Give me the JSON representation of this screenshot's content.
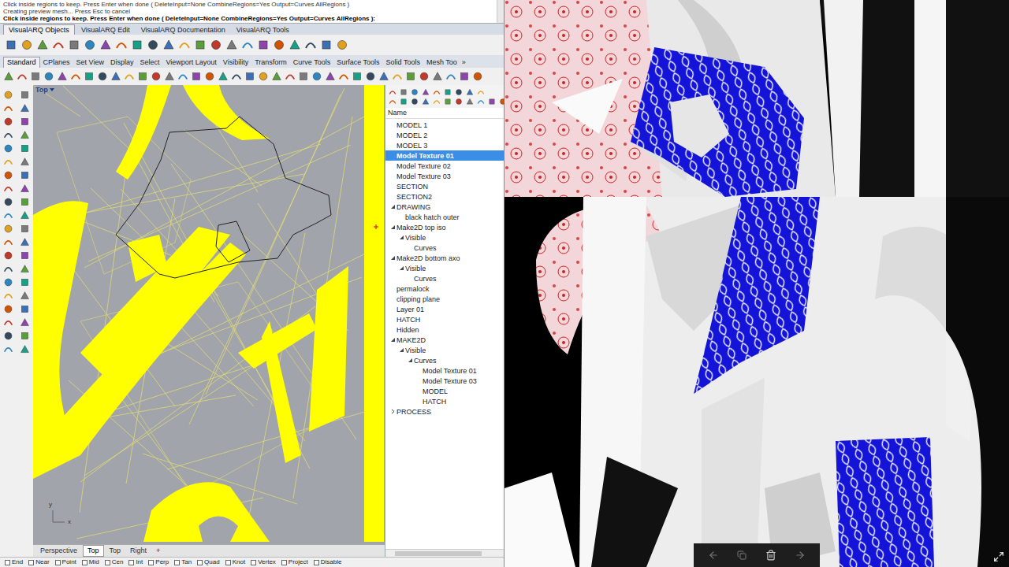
{
  "command": {
    "history": [
      "Click inside regions to keep. Press Enter when done ( DeleteInput=None  CombineRegions=Yes  Output=Curves  AllRegions )",
      "Creating preview mesh... Press Esc to cancel"
    ],
    "prompt": "Click inside regions to keep. Press Enter when done ( DeleteInput=None  CombineRegions=Yes  Output=Curves  AllRegions ):"
  },
  "plugin_tabs": [
    {
      "label": "VisualARQ Objects",
      "selected": true
    },
    {
      "label": "VisualARQ Edit",
      "selected": false
    },
    {
      "label": "VisualARQ Documentation",
      "selected": false
    },
    {
      "label": "VisualARQ Tools",
      "selected": false
    }
  ],
  "toolbar_tabs": [
    {
      "label": "Standard",
      "selected": true
    },
    {
      "label": "CPlanes",
      "selected": false
    },
    {
      "label": "Set View",
      "selected": false
    },
    {
      "label": "Display",
      "selected": false
    },
    {
      "label": "Select",
      "selected": false
    },
    {
      "label": "Viewport Layout",
      "selected": false
    },
    {
      "label": "Visibility",
      "selected": false
    },
    {
      "label": "Transform",
      "selected": false
    },
    {
      "label": "Curve Tools",
      "selected": false
    },
    {
      "label": "Surface Tools",
      "selected": false
    },
    {
      "label": "Solid Tools",
      "selected": false
    },
    {
      "label": "Mesh Too",
      "selected": false
    }
  ],
  "toolbar_tabs_overflow": "»",
  "viewport": {
    "label": "Top",
    "axis_x": "x",
    "axis_y": "y"
  },
  "layers": {
    "header": "Name",
    "items": [
      {
        "name": "MODEL 1",
        "level": 0,
        "expandable": false,
        "expanded": false,
        "selected": false
      },
      {
        "name": "MODEL 2",
        "level": 0,
        "expandable": false,
        "expanded": false,
        "selected": false
      },
      {
        "name": "MODEL 3",
        "level": 0,
        "expandable": false,
        "expanded": false,
        "selected": false
      },
      {
        "name": "Model Texture 01",
        "level": 0,
        "expandable": false,
        "expanded": false,
        "selected": true
      },
      {
        "name": "Model Texture 02",
        "level": 0,
        "expandable": false,
        "expanded": false,
        "selected": false
      },
      {
        "name": "Model Texture 03",
        "level": 0,
        "expandable": false,
        "expanded": false,
        "selected": false
      },
      {
        "name": "SECTION",
        "level": 0,
        "expandable": false,
        "expanded": false,
        "selected": false
      },
      {
        "name": "SECTION2",
        "level": 0,
        "expandable": false,
        "expanded": false,
        "selected": false
      },
      {
        "name": "DRAWING",
        "level": 0,
        "expandable": true,
        "expanded": true,
        "selected": false
      },
      {
        "name": "black hatch outer",
        "level": 1,
        "expandable": false,
        "expanded": false,
        "selected": false
      },
      {
        "name": "Make2D top iso",
        "level": 0,
        "expandable": true,
        "expanded": true,
        "selected": false
      },
      {
        "name": "Visible",
        "level": 1,
        "expandable": true,
        "expanded": true,
        "selected": false
      },
      {
        "name": "Curves",
        "level": 2,
        "expandable": false,
        "expanded": false,
        "selected": false
      },
      {
        "name": "Make2D bottom axo",
        "level": 0,
        "expandable": true,
        "expanded": true,
        "selected": false
      },
      {
        "name": "Visible",
        "level": 1,
        "expandable": true,
        "expanded": true,
        "selected": false
      },
      {
        "name": "Curves",
        "level": 2,
        "expandable": false,
        "expanded": false,
        "selected": false
      },
      {
        "name": "permalock",
        "level": 0,
        "expandable": false,
        "expanded": false,
        "selected": false
      },
      {
        "name": "clipping plane",
        "level": 0,
        "expandable": false,
        "expanded": false,
        "selected": false
      },
      {
        "name": "Layer 01",
        "level": 0,
        "expandable": false,
        "expanded": false,
        "selected": false
      },
      {
        "name": "HATCH",
        "level": 0,
        "expandable": false,
        "expanded": false,
        "selected": false
      },
      {
        "name": "Hidden",
        "level": 0,
        "expandable": false,
        "expanded": false,
        "selected": false
      },
      {
        "name": "MAKE2D",
        "level": 0,
        "expandable": true,
        "expanded": true,
        "selected": false
      },
      {
        "name": "Visible",
        "level": 1,
        "expandable": true,
        "expanded": true,
        "selected": false
      },
      {
        "name": "Curves",
        "level": 2,
        "expandable": true,
        "expanded": true,
        "selected": false
      },
      {
        "name": "Model Texture 01",
        "level": 3,
        "expandable": false,
        "expanded": false,
        "selected": false
      },
      {
        "name": "Model Texture 03",
        "level": 3,
        "expandable": false,
        "expanded": false,
        "selected": false
      },
      {
        "name": "MODEL",
        "level": 3,
        "expandable": false,
        "expanded": false,
        "selected": false
      },
      {
        "name": "HATCH",
        "level": 3,
        "expandable": false,
        "expanded": false,
        "selected": false
      },
      {
        "name": "PROCESS",
        "level": 0,
        "expandable": true,
        "expanded": false,
        "selected": false
      }
    ]
  },
  "viewport_tabs": [
    {
      "label": "Perspective",
      "selected": false
    },
    {
      "label": "Top",
      "selected": true
    },
    {
      "label": "Top",
      "selected": false
    },
    {
      "label": "Right",
      "selected": false
    },
    {
      "label": "+",
      "selected": false
    }
  ],
  "osnaps": [
    {
      "label": "End",
      "checked": false
    },
    {
      "label": "Near",
      "checked": false
    },
    {
      "label": "Point",
      "checked": false
    },
    {
      "label": "Mid",
      "checked": false
    },
    {
      "label": "Cen",
      "checked": false
    },
    {
      "label": "Int",
      "checked": false
    },
    {
      "label": "Perp",
      "checked": false
    },
    {
      "label": "Tan",
      "checked": false
    },
    {
      "label": "Quad",
      "checked": false
    },
    {
      "label": "Knot",
      "checked": false
    },
    {
      "label": "Vertex",
      "checked": false
    },
    {
      "label": "Project",
      "checked": false
    },
    {
      "label": "Disable",
      "checked": false
    }
  ]
}
